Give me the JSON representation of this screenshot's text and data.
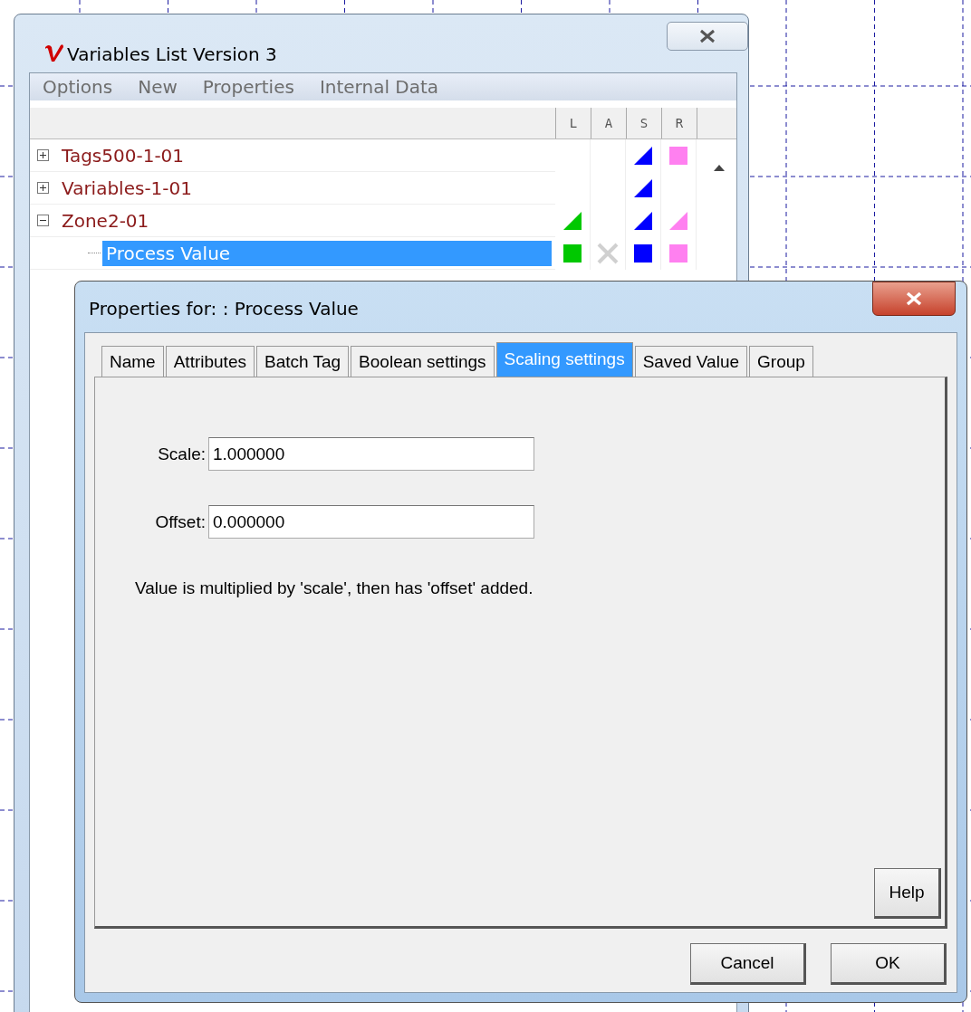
{
  "list_window": {
    "title": "Variables List Version 3",
    "menu": [
      "Options",
      "New",
      "Properties",
      "Internal Data"
    ],
    "columns": [
      {
        "label": "L",
        "color": "#00c800"
      },
      {
        "label": "A",
        "color": "#d0d0d0"
      },
      {
        "label": "S",
        "color": "#0000ff"
      },
      {
        "label": "R",
        "color": "#ff80f0"
      }
    ],
    "tree": [
      {
        "label": "Tags500-1-01",
        "expanded": false,
        "selected": false,
        "cells": [
          {
            "kind": "empty"
          },
          {
            "kind": "empty"
          },
          {
            "kind": "triangle"
          },
          {
            "kind": "square"
          }
        ]
      },
      {
        "label": "Variables-1-01",
        "expanded": false,
        "selected": false,
        "cells": [
          {
            "kind": "empty"
          },
          {
            "kind": "empty"
          },
          {
            "kind": "triangle"
          },
          {
            "kind": "empty"
          }
        ]
      },
      {
        "label": "Zone2-01",
        "expanded": true,
        "selected": false,
        "cells": [
          {
            "kind": "triangle"
          },
          {
            "kind": "empty"
          },
          {
            "kind": "triangle"
          },
          {
            "kind": "triangle"
          }
        ],
        "children": [
          {
            "label": "Process Value",
            "selected": true,
            "cells": [
              {
                "kind": "square"
              },
              {
                "kind": "cross"
              },
              {
                "kind": "square"
              },
              {
                "kind": "square"
              }
            ]
          }
        ]
      }
    ]
  },
  "dialog": {
    "title": "Properties for: : Process Value",
    "tabs": [
      {
        "label": "Name",
        "selected": false
      },
      {
        "label": "Attributes",
        "selected": false
      },
      {
        "label": "Batch Tag",
        "selected": false
      },
      {
        "label": "Boolean settings",
        "selected": false
      },
      {
        "label": "Scaling settings",
        "selected": true
      },
      {
        "label": "Saved Value",
        "selected": false
      },
      {
        "label": "Group",
        "selected": false
      }
    ],
    "fields": [
      {
        "label": "Scale:",
        "value": "1.000000"
      },
      {
        "label": "Offset:",
        "value": "0.000000"
      }
    ],
    "note": "Value is multiplied by 'scale', then has 'offset' added.",
    "help_button": "Help",
    "buttons": [
      "Cancel",
      "OK"
    ]
  }
}
